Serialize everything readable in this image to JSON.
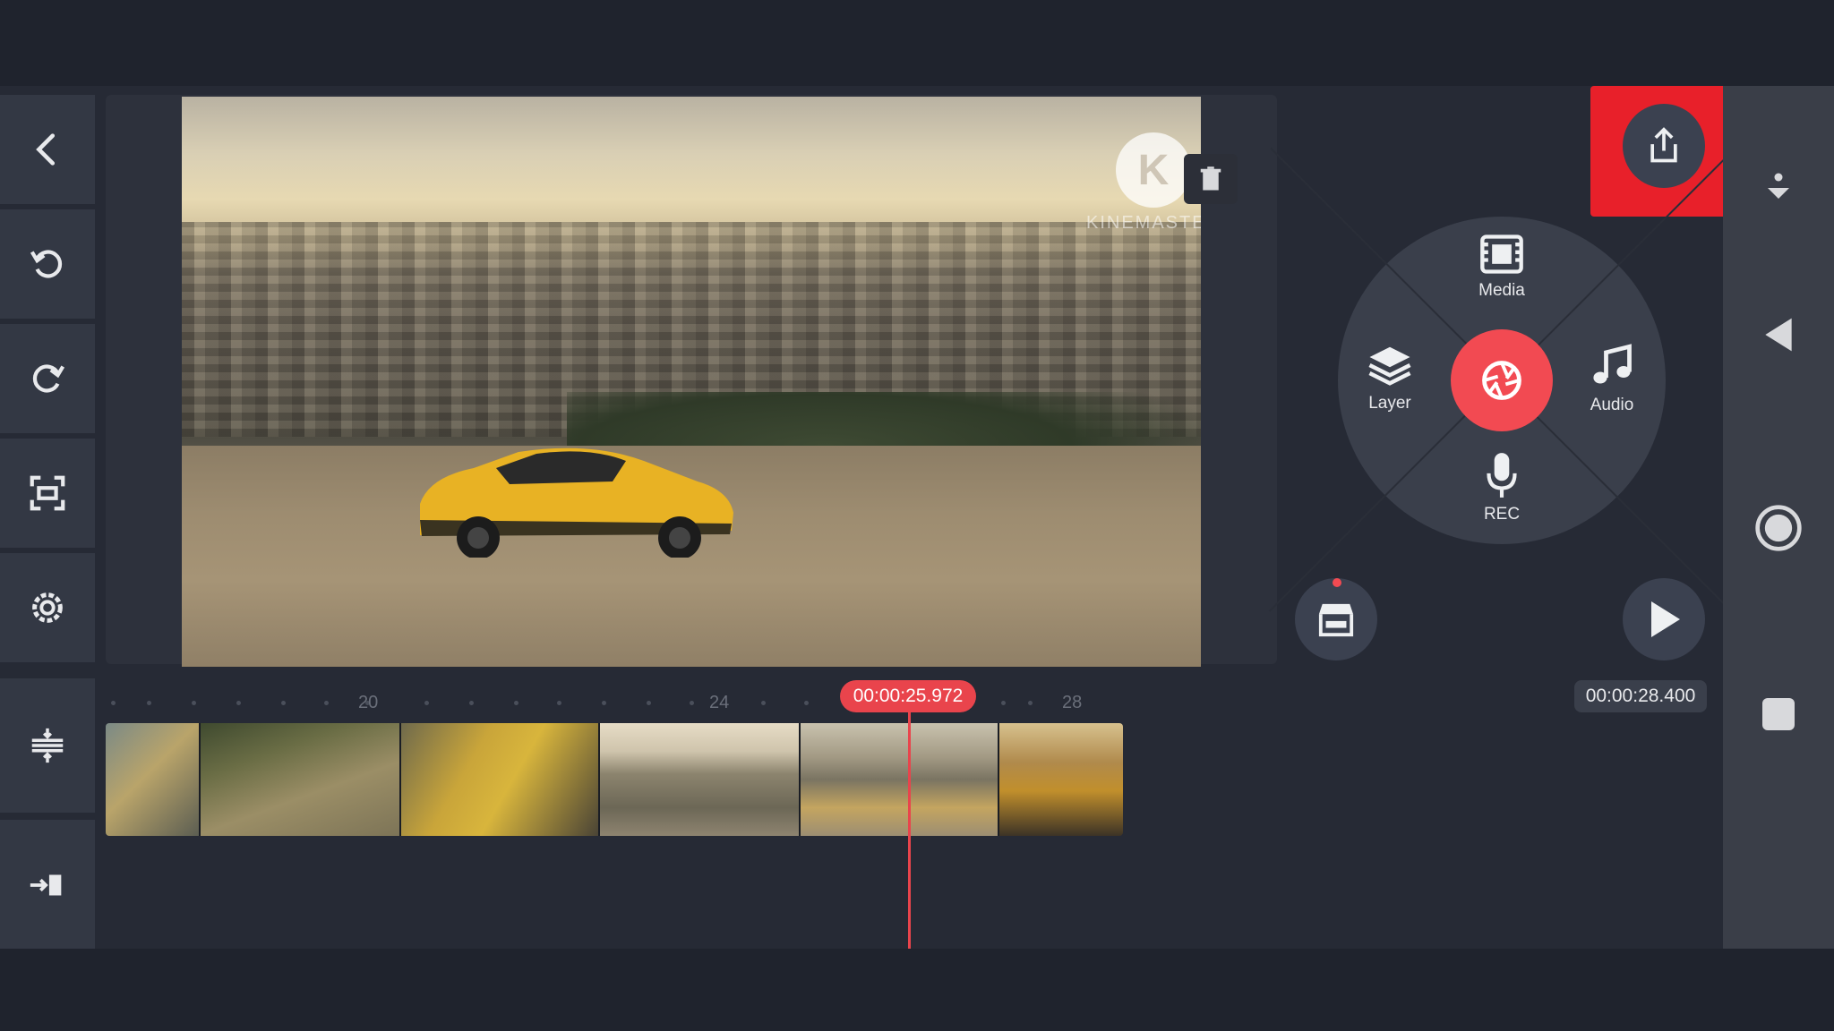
{
  "watermark": {
    "brand": "KINEMASTER",
    "logo_letter": "K"
  },
  "wheel": {
    "media_label": "Media",
    "layer_label": "Layer",
    "audio_label": "Audio",
    "rec_label": "REC"
  },
  "timeline": {
    "ruler_labels": [
      "20",
      "24",
      "28"
    ],
    "current_time": "00:00:25.972",
    "total_time": "00:00:28.400"
  },
  "colors": {
    "accent": "#f24a52",
    "highlight": "#e8202a",
    "panel": "#333844",
    "background": "#262a35"
  },
  "icons": {
    "left_toolbar": [
      "back-icon",
      "undo-icon",
      "redo-icon",
      "screen-capture-icon",
      "settings-icon",
      "timeline-adjust-icon",
      "jump-to-end-icon"
    ],
    "system_bar": [
      "scroll-down-icon",
      "nav-back-icon",
      "nav-home-icon",
      "nav-recents-icon"
    ]
  }
}
